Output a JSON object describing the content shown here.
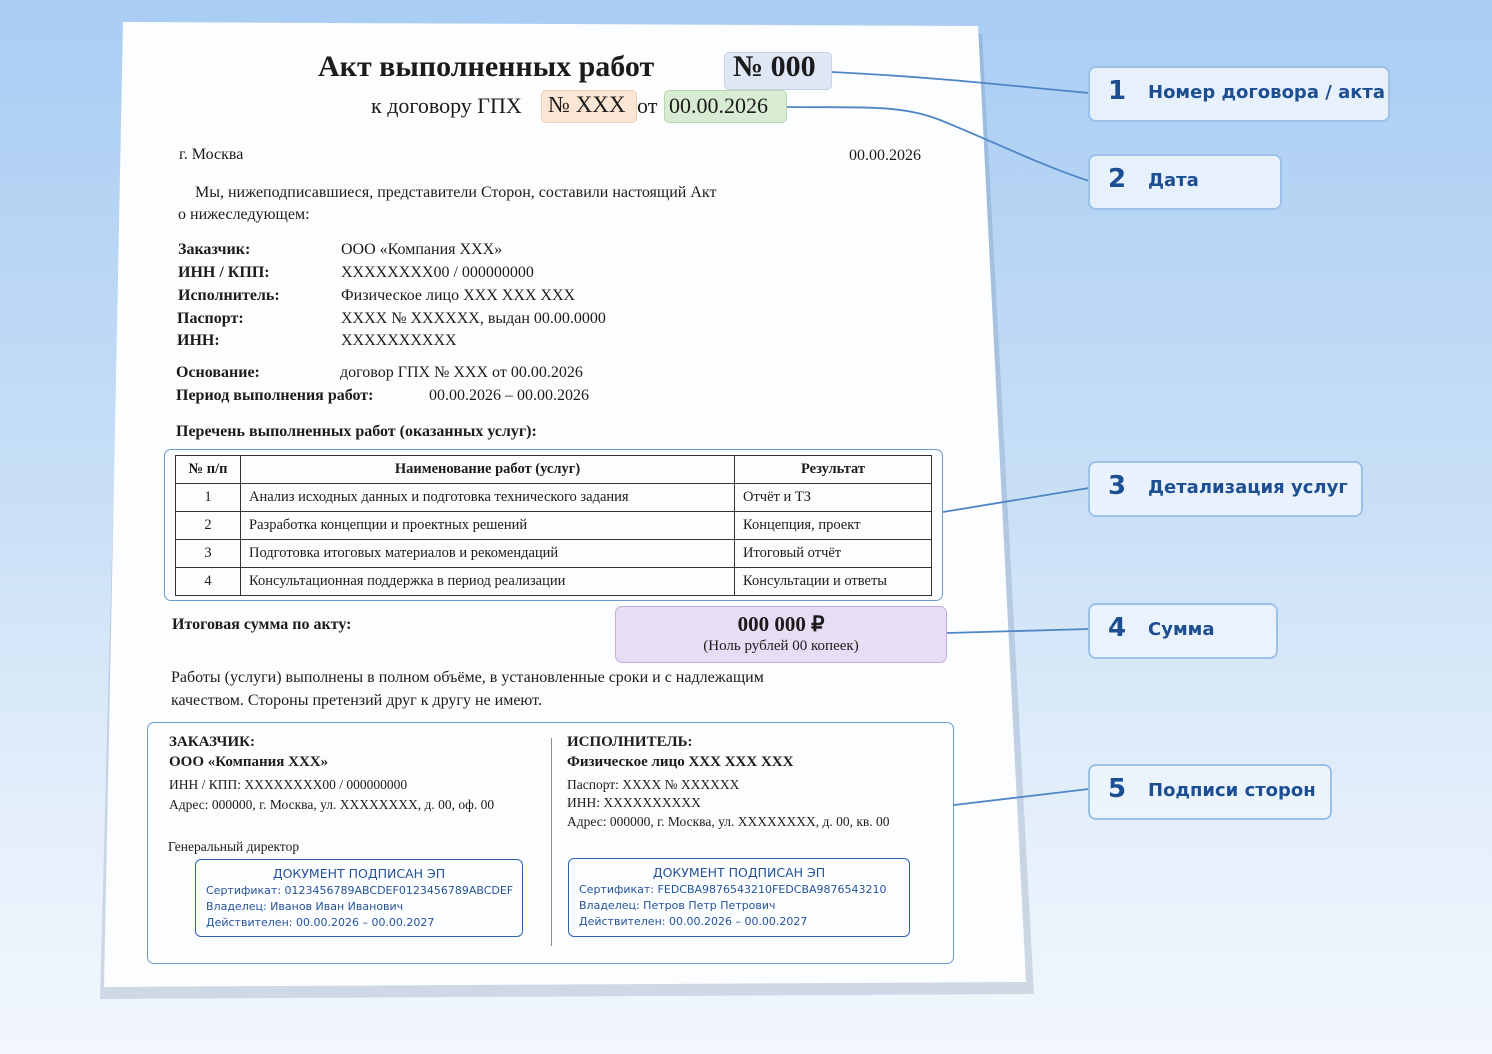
{
  "document": {
    "title": "Акт выполненных работ",
    "act_number": "№ 000",
    "subtitle_prefix": "к договору ГПХ",
    "contract_number": "№ XXX",
    "subtitle_from": "от",
    "contract_date": "00.00.2026",
    "city": "г. Москва",
    "doc_date": "00.00.2026",
    "intro_line1": "Мы, нижеподписавшиеся, представители Сторон, составили настоящий Акт",
    "intro_line2": "о нижеследующем:",
    "parties": [
      {
        "label": "Заказчик:",
        "value": "ООО «Компания XXX»"
      },
      {
        "label": "ИНН / КПП:",
        "value": "XXXXXXXX00 / 000000000"
      },
      {
        "label": "Исполнитель:",
        "value": "Физическое лицо XXX XXX XXX"
      },
      {
        "label": "Паспорт:",
        "value": "XXXX № XXXXXX, выдан 00.00.0000"
      },
      {
        "label": "ИНН:",
        "value": "XXXXXXXXXX"
      }
    ],
    "basis_label": "Основание:",
    "basis_value": "договор ГПХ № XXX от 00.00.2026",
    "period_label": "Период выполнения работ:",
    "period_value": "00.00.2026 – 00.00.2026",
    "works_heading": "Перечень выполненных работ (оказанных услуг):",
    "table": {
      "headers": [
        "№ п/п",
        "Наименование работ (услуг)",
        "Результат"
      ],
      "rows": [
        [
          "1",
          "Анализ исходных данных и подготовка технического задания",
          "Отчёт и ТЗ"
        ],
        [
          "2",
          "Разработка концепции и проектных решений",
          "Концепция, проект"
        ],
        [
          "3",
          "Подготовка итоговых материалов и рекомендаций",
          "Итоговый отчёт"
        ],
        [
          "4",
          "Консультационная поддержка в период реализации",
          "Консультации и ответы"
        ]
      ]
    },
    "total_label": "Итоговая сумма по акту:",
    "total_amount": "000 000 ₽",
    "total_words": "(Ноль рублей 00 копеек)",
    "closing_line1": "Работы (услуги) выполнены в полном объёме, в установленные сроки и с надлежащим",
    "closing_line2": "качеством. Стороны претензий друг к другу не имеют.",
    "customer": {
      "heading": "ЗАКАЗЧИК:",
      "name": "ООО «Компания XXX»",
      "inn": "ИНН / КПП: XXXXXXXX00 / 000000000",
      "address": "Адрес: 000000, г. Москва, ул. XXXXXXXX, д. 00, оф. 00",
      "position": "Генеральный директор",
      "stamp": {
        "title": "ДОКУМЕНТ ПОДПИСАН ЭП",
        "cert": "Сертификат: 0123456789ABCDEF0123456789ABCDEF",
        "owner": "Владелец: Иванов Иван Иванович",
        "valid": "Действителен: 00.00.2026 – 00.00.2027"
      }
    },
    "contractor": {
      "heading": "ИСПОЛНИТЕЛЬ:",
      "name": "Физическое лицо XXX XXX XXX",
      "passport": "Паспорт: XXXX № XXXXXX",
      "inn": "ИНН: XXXXXXXXXX",
      "address": "Адрес: 000000, г. Москва, ул. XXXXXXXX, д. 00, кв. 00",
      "stamp": {
        "title": "ДОКУМЕНТ ПОДПИСАН ЭП",
        "cert": "Сертификат: FEDCBA9876543210FEDCBA9876543210",
        "owner": "Владелец: Петров Петр Петрович",
        "valid": "Действителен: 00.00.2026 – 00.00.2027"
      }
    }
  },
  "callouts": [
    {
      "num": "1",
      "label": "Номер договора / акта"
    },
    {
      "num": "2",
      "label": "Дата"
    },
    {
      "num": "3",
      "label": "Детализация услуг"
    },
    {
      "num": "4",
      "label": "Сумма"
    },
    {
      "num": "5",
      "label": "Подписи сторон"
    }
  ],
  "colors": {
    "callout_line": "#4f86c6",
    "act_number_chip": "#dfe7f4",
    "contract_number_chip": "#fbe6d4",
    "date_chip": "#d8ebd3",
    "sum_box": "#e7ddf4",
    "stamp_text": "#25539a"
  }
}
